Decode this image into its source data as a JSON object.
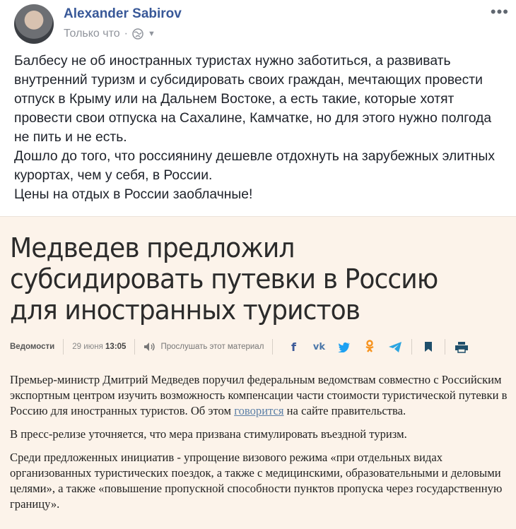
{
  "post": {
    "author": "Alexander Sabirov",
    "timestamp": "Только что",
    "more_label": "•••",
    "lines": [
      "Балбесу не об иностранных туристах нужно заботиться, а развивать внутренний туризм и субсидировать своих граждан, мечтающих провести отпуск в Крыму или на Дальнем Востоке, а есть такие, которые хотят провести свои отпуска на Сахалине, Камчатке, но для этого нужно полгода не пить и не есть.",
      "Дошло до того, что россиянину дешевле отдохнуть на зарубежных элитных курортах, чем у себя, в России.",
      "Цены на отдых в России заоблачные!"
    ]
  },
  "article": {
    "headline": "Медведев предложил субсидировать путевки в Россию для иностранных туристов",
    "source": "Ведомости",
    "date": "29 июня",
    "time": "13:05",
    "listen_label": "Прослушать этот материал",
    "p1_before": "Премьер-министр Дмитрий Медведев поручил федеральным ведомствам совместно с Российским экспортным центром изучить возможность компенсации части стоимости туристической путевки в Россию для иностранных туристов. Об этом ",
    "p1_link": "говорится",
    "p1_after": " на сайте правительства.",
    "p2": "В пресс-релизе уточняется, что мера призвана стимулировать въездной туризм.",
    "p3": "Среди предложенных инициатив - упрощение визового режима «при отдельных видах организованных туристических поездок, а также с медицинскими, образовательными и деловыми целями», а также «повышение пропускной способности пунктов пропуска через государственную границу»."
  },
  "icons": {
    "share": [
      "facebook-icon",
      "vk-icon",
      "twitter-icon",
      "odnoklassniki-icon",
      "telegram-icon",
      "bookmark-icon",
      "print-icon"
    ]
  },
  "colors": {
    "author": "#385898",
    "card_bg": "#fcf3ea",
    "link": "#5b7fa6"
  }
}
